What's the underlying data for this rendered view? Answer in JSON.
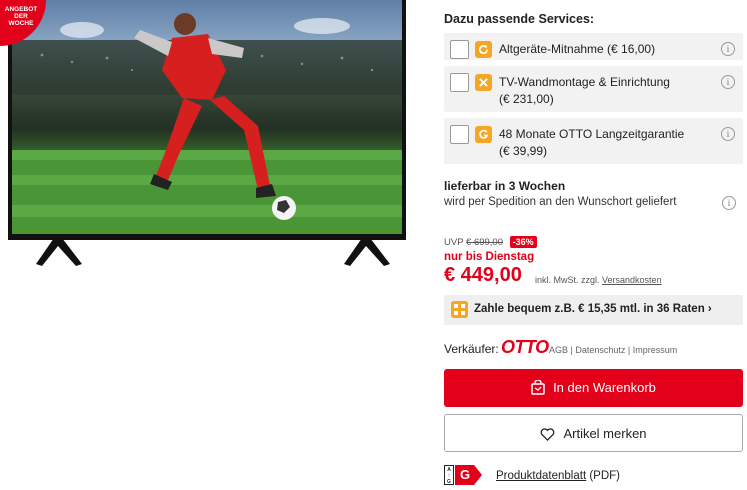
{
  "badge": {
    "line1": "ANGEBOT",
    "line2": "DER",
    "line3": "WOCHE"
  },
  "services": {
    "title": "Dazu passende Services:",
    "items": [
      {
        "line1": "Altgeräte-Mitnahme (€ 16,00)",
        "line2": "",
        "icon": "refresh-icon"
      },
      {
        "line1": "TV-Wandmontage & Einrichtung",
        "line2": "(€ 231,00)",
        "icon": "tools-icon"
      },
      {
        "line1": "48 Monate OTTO Langzeitgarantie",
        "line2": "(€ 39,99)",
        "icon": "guarantee-icon"
      }
    ],
    "info_glyph": "i"
  },
  "delivery": {
    "title": "lieferbar in 3 Wochen",
    "subtitle": "wird per Spedition an den Wunschort geliefert"
  },
  "pricing": {
    "uvp_label": "UVP",
    "uvp_value": "€ 699,00",
    "discount": "-36%",
    "until": "nur bis Dienstag",
    "price": "€ 449,00",
    "price_note": "inkl. MwSt. zzgl.",
    "shipping_link": "Versandkosten"
  },
  "installment": {
    "text": "Zahle bequem z.B. € 15,35 mtl. in 36 Raten ›"
  },
  "seller": {
    "label": "Verkäufer:",
    "logo": "OTTO",
    "links": "AGB | Datenschutz | Impressum"
  },
  "actions": {
    "cart_label": "In den Warenkorb",
    "wishlist_label": "Artikel merken"
  },
  "energy": {
    "scale_top": "A",
    "scale_mid": "↑",
    "scale_bottom": "G",
    "class": "G",
    "class_color": "#e3001b",
    "datasheet_link": "Produktdatenblatt",
    "datasheet_suffix": " (PDF)"
  },
  "colors": {
    "accent": "#e3001b",
    "service_icon": "#f5a623"
  }
}
